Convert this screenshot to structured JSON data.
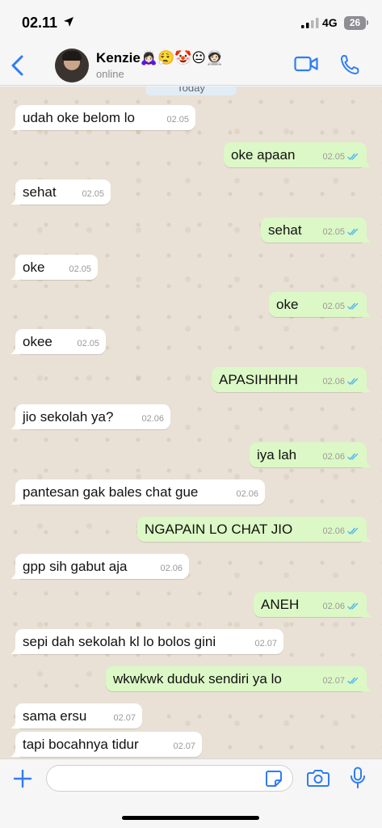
{
  "status_bar": {
    "time": "02.11",
    "network": "4G",
    "battery": "26"
  },
  "header": {
    "contact_name": "Kenzie🙇🏻‍♀️😮‍💨🤡😐🧑🏻‍🚀",
    "contact_status": "online"
  },
  "date_separator": "Today",
  "messages": [
    {
      "dir": "in",
      "text": "udah oke belom lo",
      "time": "02.05"
    },
    {
      "dir": "out",
      "text": "oke apaan",
      "time": "02.05"
    },
    {
      "dir": "in",
      "text": "sehat",
      "time": "02.05"
    },
    {
      "dir": "out",
      "text": "sehat",
      "time": "02.05"
    },
    {
      "dir": "in",
      "text": "oke",
      "time": "02.05"
    },
    {
      "dir": "out",
      "text": "oke",
      "time": "02.05"
    },
    {
      "dir": "in",
      "text": "okee",
      "time": "02.05"
    },
    {
      "dir": "out",
      "text": "APASIHHHH",
      "time": "02.06"
    },
    {
      "dir": "in",
      "text": "jio sekolah ya?",
      "time": "02.06"
    },
    {
      "dir": "out",
      "text": "iya lah",
      "time": "02.06"
    },
    {
      "dir": "in",
      "text": "pantesan gak bales chat gue",
      "time": "02.06"
    },
    {
      "dir": "out",
      "text": "NGAPAIN LO CHAT JIO",
      "time": "02.06"
    },
    {
      "dir": "in",
      "text": "gpp sih gabut aja",
      "time": "02.06"
    },
    {
      "dir": "out",
      "text": "ANEH",
      "time": "02.06"
    },
    {
      "dir": "in",
      "text": "sepi dah sekolah kl lo bolos gini",
      "time": "02.07"
    },
    {
      "dir": "out",
      "text": "wkwkwk duduk sendiri ya lo",
      "time": "02.07"
    },
    {
      "dir": "in",
      "text": "sama ersu",
      "time": "02.07"
    },
    {
      "dir": "in",
      "text": "tapi bocahnya tidur",
      "time": "02.07"
    }
  ],
  "input_bar": {
    "placeholder": ""
  },
  "colors": {
    "accent": "#2f7cf6",
    "outgoing_bubble": "#dcf8c6",
    "incoming_bubble": "#ffffff",
    "read_ticks": "#4fb6ec",
    "chat_background": "#e9e1d5"
  }
}
